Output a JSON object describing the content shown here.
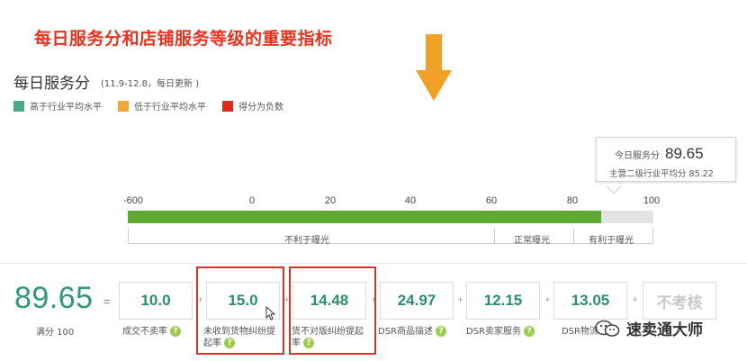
{
  "headline": "每日服务分和店铺服务等级的重要指标",
  "section": {
    "title": "每日服务分",
    "date_range": "(11.9-12.8，每日更新 )"
  },
  "legend": [
    {
      "label": "高于行业平均水平",
      "color": "#4aaa86"
    },
    {
      "label": "低于行业平均水平",
      "color": "#f0a73a"
    },
    {
      "label": "得分为负数",
      "color": "#e02a1e"
    }
  ],
  "tooltip": {
    "today_label": "今日服务分",
    "today_value": "89.65",
    "industry_label": "主营二级行业平均分",
    "industry_value": "85.22"
  },
  "scale": {
    "ticks": [
      "-600",
      "0",
      "20",
      "40",
      "60",
      "80",
      "100"
    ],
    "score_fraction": 0.9
  },
  "zones": [
    "不利于曝光",
    "正常曝光",
    "有利于曝光"
  ],
  "total": {
    "value": "89.65",
    "equals": "=",
    "full_score": "满分 100"
  },
  "metrics": [
    {
      "value": "10.0",
      "label": "成交不卖率"
    },
    {
      "value": "15.0",
      "label_line1": "未收到货物纠纷提",
      "label_line2": "起率"
    },
    {
      "value": "14.48",
      "label_line1": "货不对版纠纷提起",
      "label_line2": "率"
    },
    {
      "value": "24.97",
      "label": "DSR商品描述"
    },
    {
      "value": "12.15",
      "label": "DSR卖家服务"
    },
    {
      "value": "13.05",
      "label": "DSR物流服务"
    },
    {
      "value": "不考核"
    }
  ],
  "plus_sign": "+",
  "watermark": "速卖通大师",
  "colors": {
    "accent_green": "#2f9b74",
    "bar_green": "#5ea936",
    "highlight_red": "#d8332b"
  }
}
